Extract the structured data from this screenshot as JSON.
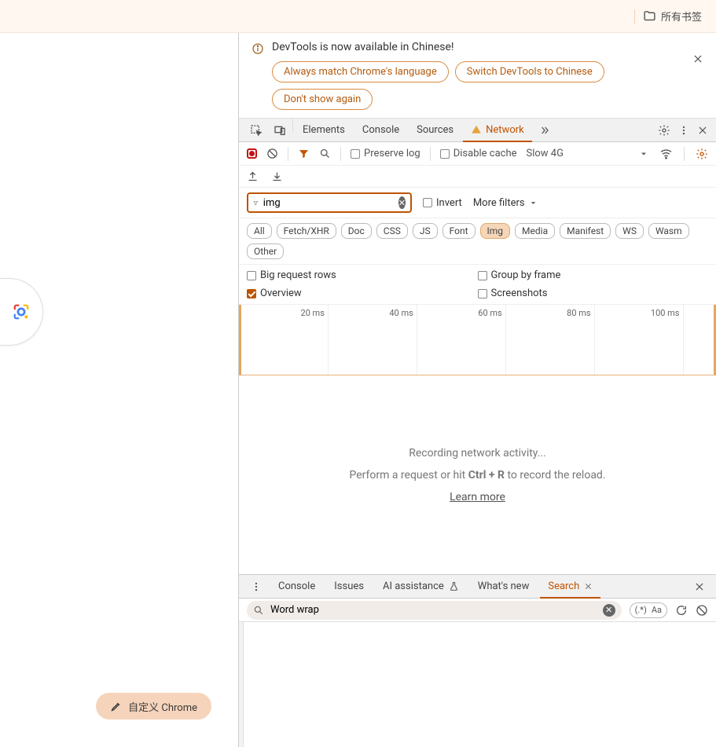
{
  "topbar": {
    "bookmarks_label": "所有书签"
  },
  "info": {
    "title": "DevTools is now available in Chinese!",
    "btn_match": "Always match Chrome's language",
    "btn_switch": "Switch DevTools to Chinese",
    "btn_dontshow": "Don't show again"
  },
  "tabs": {
    "elements": "Elements",
    "console": "Console",
    "sources": "Sources",
    "network": "Network"
  },
  "toolbar": {
    "preserve": "Preserve log",
    "disable_cache": "Disable cache",
    "throttle": "Slow 4G"
  },
  "filter": {
    "value": "img",
    "invert": "Invert",
    "more": "More filters"
  },
  "chips": {
    "all": "All",
    "fetch": "Fetch/XHR",
    "doc": "Doc",
    "css": "CSS",
    "js": "JS",
    "font": "Font",
    "img": "Img",
    "media": "Media",
    "manifest": "Manifest",
    "ws": "WS",
    "wasm": "Wasm",
    "other": "Other"
  },
  "opts": {
    "bigrows": "Big request rows",
    "overview": "Overview",
    "groupframe": "Group by frame",
    "screenshots": "Screenshots"
  },
  "waterfall": {
    "t20": "20 ms",
    "t40": "40 ms",
    "t60": "60 ms",
    "t80": "80 ms",
    "t100": "100 ms"
  },
  "empty": {
    "line1": "Recording network activity...",
    "line2a": "Perform a request or hit ",
    "shortcut": "Ctrl + R",
    "line2b": " to record the reload.",
    "learn": "Learn more"
  },
  "drawer": {
    "tabs": {
      "console": "Console",
      "issues": "Issues",
      "ai": "AI assistance",
      "whatsnew": "What's new",
      "search": "Search"
    },
    "search_value": "Word wrap"
  },
  "customize": "自定义 Chrome"
}
